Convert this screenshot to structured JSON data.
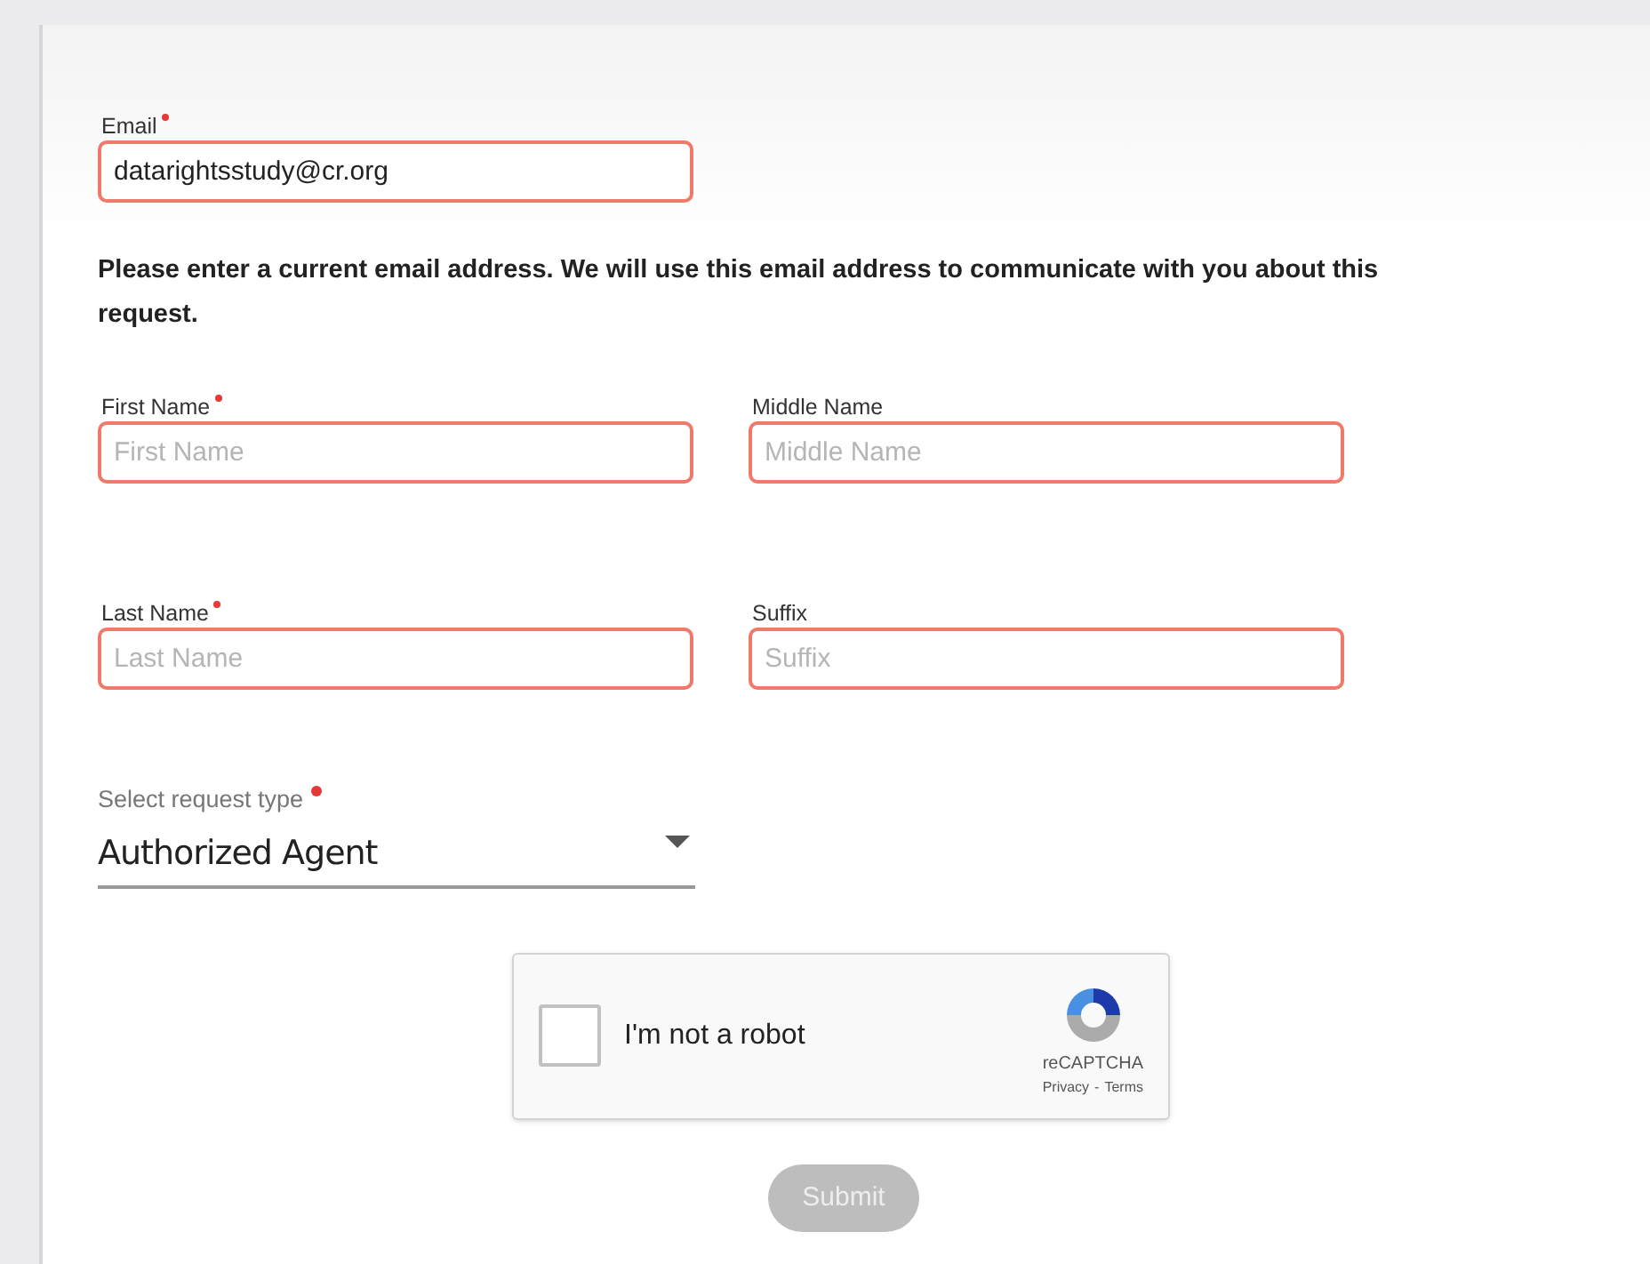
{
  "email": {
    "label": "Email",
    "required": true,
    "value": "datarightsstudy@cr.org",
    "invalid": true
  },
  "notice": "Please enter a current email address. We will use this email address to communicate with you about this request.",
  "name_rows": [
    [
      {
        "label": "First Name",
        "required": true,
        "placeholder": "First Name",
        "invalid": true
      },
      {
        "label": "Middle Name",
        "required": false,
        "placeholder": "Middle Name",
        "invalid": true
      }
    ],
    [
      {
        "label": "Last Name",
        "required": true,
        "placeholder": "Last Name",
        "invalid": true
      },
      {
        "label": "Suffix",
        "required": false,
        "placeholder": "Suffix",
        "invalid": true
      }
    ]
  ],
  "request_type": {
    "label": "Select request type",
    "required": true,
    "value": "Authorized Agent"
  },
  "captcha": {
    "checked": false,
    "label": "I'm not a robot",
    "brand": "reCAPTCHA",
    "privacy": "Privacy",
    "separator": "-",
    "terms": "Terms"
  },
  "submit": {
    "label": "Submit",
    "disabled": true
  }
}
